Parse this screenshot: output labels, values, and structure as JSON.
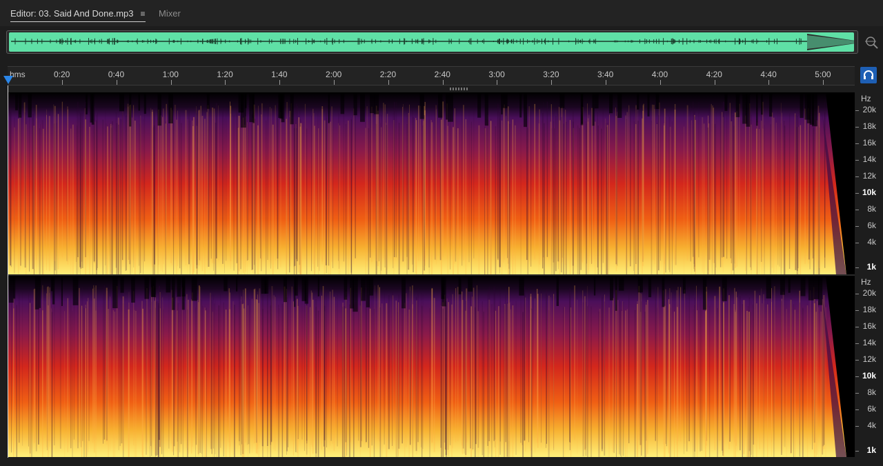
{
  "tabs": {
    "editor_label": "Editor: 03. Said And Done.mp3",
    "menu_glyph": "≡",
    "mixer_label": "Mixer"
  },
  "timeline": {
    "unit_label": "hms",
    "ticks": [
      "0:20",
      "0:40",
      "1:00",
      "1:20",
      "1:40",
      "2:00",
      "2:20",
      "2:40",
      "3:00",
      "3:20",
      "3:40",
      "4:00",
      "4:20",
      "4:40",
      "5:00"
    ]
  },
  "freq_scale": {
    "unit": "Hz",
    "labels": [
      "20k",
      "18k",
      "16k",
      "14k",
      "12k",
      "10k",
      "8k",
      "6k",
      "4k",
      "1k"
    ],
    "emphasized": [
      "10k",
      "1k"
    ]
  },
  "colors": {
    "overview_wave": "#5fe0a6",
    "accent_blue": "#2b86e8"
  },
  "icons": {
    "zoom": "zoom-magnifier-icon",
    "snap": "headphone-snap-icon",
    "playhead": "playhead-marker-icon"
  }
}
